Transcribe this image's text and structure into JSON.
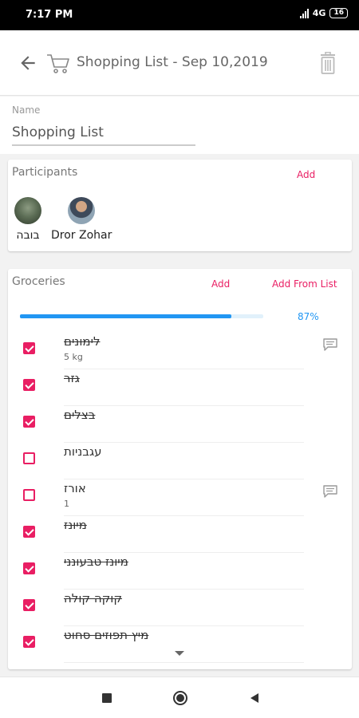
{
  "status_bar": {
    "time": "7:17 PM",
    "network": "4G",
    "battery": "16"
  },
  "app_bar": {
    "title": "Shopping List - Sep 10,2019",
    "back_icon": "arrow-back-icon",
    "cart_icon": "cart-icon",
    "delete_icon": "trash-icon"
  },
  "name_field": {
    "label": "Name",
    "value": "Shopping List"
  },
  "participants": {
    "heading": "Participants",
    "add_label": "Add",
    "people": [
      {
        "name": "בובה"
      },
      {
        "name": "Dror Zohar"
      }
    ]
  },
  "groceries": {
    "heading": "Groceries",
    "add_label": "Add",
    "add_from_list_label": "Add From List",
    "progress": 87,
    "progress_label": "87%",
    "items": [
      {
        "name": "לימונים",
        "qty": "5 kg",
        "checked": true,
        "has_comment": true
      },
      {
        "name": "גזר",
        "qty": "",
        "checked": true,
        "has_comment": false
      },
      {
        "name": "בצלים",
        "qty": "",
        "checked": true,
        "has_comment": false
      },
      {
        "name": "עגבניות",
        "qty": "",
        "checked": false,
        "has_comment": false
      },
      {
        "name": "אורז",
        "qty": "1",
        "checked": false,
        "has_comment": true
      },
      {
        "name": "מיונז",
        "qty": "",
        "checked": true,
        "has_comment": false
      },
      {
        "name": "מיונז טבעונני",
        "qty": "",
        "checked": true,
        "has_comment": false
      },
      {
        "name": "קוקה קולה",
        "qty": "",
        "checked": true,
        "has_comment": false
      },
      {
        "name": "מיץ תפוזים סחוט",
        "qty": "",
        "checked": true,
        "has_comment": false
      }
    ]
  },
  "colors": {
    "accent": "#e91e63",
    "progress": "#2196f3"
  },
  "nav_bar": {
    "icons": [
      "recents-icon",
      "home-icon",
      "back-icon"
    ]
  }
}
